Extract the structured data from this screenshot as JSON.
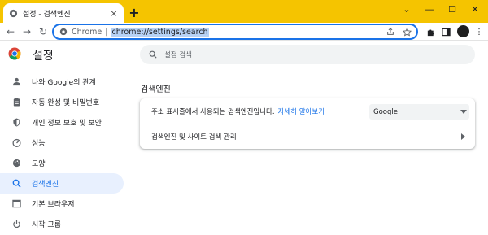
{
  "browser": {
    "tab": {
      "title": "설정 - 검색엔진",
      "close_glyph": "×",
      "favicon": "chrome-settings-icon"
    },
    "newtab_glyph": "+",
    "window_controls": {
      "dropdown": "⌄",
      "minimize": "—",
      "maximize": "☐",
      "close": "✕"
    },
    "toolbar": {
      "back": "←",
      "forward": "→",
      "reload": "↻",
      "omnibox_scheme": "Chrome",
      "omnibox_sep": "|",
      "omnibox_url": "chrome://settings/search",
      "menu": "⋮"
    }
  },
  "settings": {
    "title": "설정",
    "search_placeholder": "설정 검색",
    "sidebar": [
      {
        "label": "나와 Google의 관계",
        "icon": "person-icon"
      },
      {
        "label": "자동 완성 및 비밀번호",
        "icon": "clipboard-icon"
      },
      {
        "label": "개인 정보 보호 및 보안",
        "icon": "shield-icon"
      },
      {
        "label": "성능",
        "icon": "speedometer-icon"
      },
      {
        "label": "모양",
        "icon": "palette-icon"
      },
      {
        "label": "검색엔진",
        "icon": "search-icon",
        "active": true
      },
      {
        "label": "기본 브라우저",
        "icon": "browser-window-icon"
      },
      {
        "label": "시작 그룹",
        "icon": "power-icon"
      }
    ],
    "section_title": "검색엔진",
    "card": {
      "row1_text": "주소 표시줄에서 사용되는 검색엔진입니다.",
      "learn_more": "자세히 알아보기",
      "select_value": "Google",
      "row2_text": "검색엔진 및 사이트 검색 관리"
    }
  },
  "colors": {
    "tabstrip": "#f5c400",
    "accent": "#1a73e8",
    "active_bg": "#e8f0fe",
    "url_highlight": "#b7d2f5"
  }
}
